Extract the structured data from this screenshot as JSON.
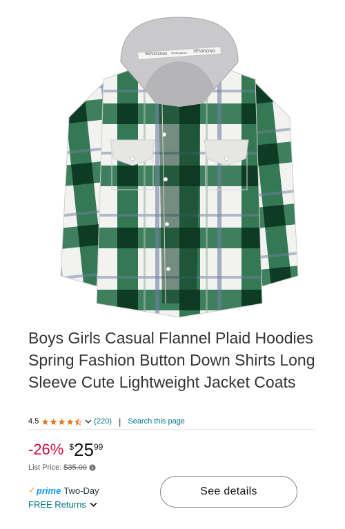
{
  "product": {
    "title": "Boys Girls Casual Flannel Plaid Hoodies Spring Fashion Button Down Shirts Long Sleeve Cute Lightweight Jacket Coats",
    "image_label": "green white plaid hooded flannel shirt",
    "tag_text_left": "SENIGONG",
    "tag_text_mid": "Kindergarten",
    "tag_text_right": "SENIGONG"
  },
  "rating": {
    "value": "4.5",
    "stars": 4.5,
    "review_count": "(220)",
    "separator": "|",
    "search_link": "Search this page"
  },
  "pricing": {
    "discount": "-26%",
    "currency": "$",
    "whole": "25",
    "fraction": "99",
    "list_price_label": "List Price:",
    "list_price": "$35.00"
  },
  "delivery": {
    "prime_check": "✓",
    "prime_label": "prime",
    "two_day": "Two-Day",
    "returns": "FREE Returns"
  },
  "actions": {
    "see_details": "See details"
  },
  "colors": {
    "discount_red": "#cc0c39",
    "link_teal": "#007185",
    "star_orange": "#de7921",
    "prime_blue": "#1399ff",
    "prime_orange": "#ff9900",
    "plaid_green": "#1f6b43"
  }
}
